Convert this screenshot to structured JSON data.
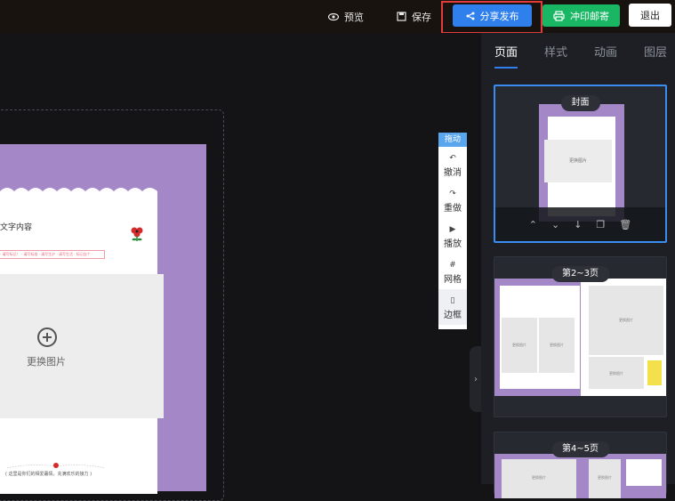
{
  "topbar": {
    "preview_label": "预览",
    "save_label": "保存",
    "share_label": "分享发布",
    "print_label": "冲印邮寄",
    "exit_label": "退出"
  },
  "canvas": {
    "text_content": "文字内容",
    "pink_line_text": "· 请写标记！ · 请写标准 · 请写生沪 · 请写生活 · 标记自个 ·",
    "replace_image_label": "更换图片",
    "footer_text": "( 这里是你们的相爱暮情，充满欢乐的接力 )"
  },
  "toolbar": {
    "drag_label": "拖动",
    "undo_label": "撤消",
    "redo_label": "重做",
    "play_label": "播放",
    "grid_label": "网格",
    "border_label": "边框"
  },
  "panel": {
    "tabs": [
      {
        "label": "页面"
      },
      {
        "label": "样式"
      },
      {
        "label": "动画"
      },
      {
        "label": "图层"
      }
    ],
    "pages": [
      {
        "label": "封面",
        "img_label": "更换图片"
      },
      {
        "label": "第2~3页",
        "img_label": "更换图片"
      },
      {
        "label": "第4~5页",
        "img_label": "更换图片"
      }
    ]
  },
  "colors": {
    "accent": "#2f80ed",
    "print_green": "#19b764",
    "highlight_red": "#e23b3b",
    "page_purple": "#a487c6"
  }
}
